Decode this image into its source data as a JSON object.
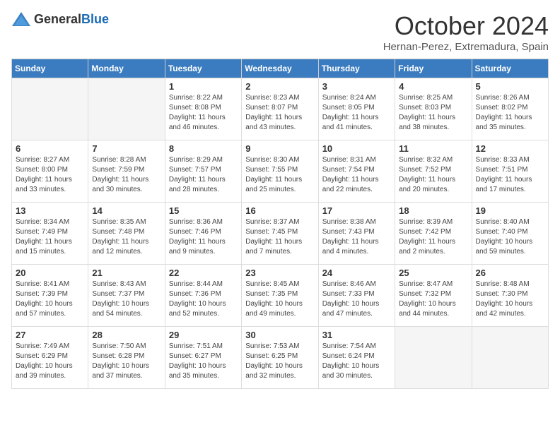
{
  "header": {
    "logo_general": "General",
    "logo_blue": "Blue",
    "month": "October 2024",
    "location": "Hernan-Perez, Extremadura, Spain"
  },
  "days_of_week": [
    "Sunday",
    "Monday",
    "Tuesday",
    "Wednesday",
    "Thursday",
    "Friday",
    "Saturday"
  ],
  "weeks": [
    [
      {
        "day": "",
        "info": ""
      },
      {
        "day": "",
        "info": ""
      },
      {
        "day": "1",
        "info": "Sunrise: 8:22 AM\nSunset: 8:08 PM\nDaylight: 11 hours and 46 minutes."
      },
      {
        "day": "2",
        "info": "Sunrise: 8:23 AM\nSunset: 8:07 PM\nDaylight: 11 hours and 43 minutes."
      },
      {
        "day": "3",
        "info": "Sunrise: 8:24 AM\nSunset: 8:05 PM\nDaylight: 11 hours and 41 minutes."
      },
      {
        "day": "4",
        "info": "Sunrise: 8:25 AM\nSunset: 8:03 PM\nDaylight: 11 hours and 38 minutes."
      },
      {
        "day": "5",
        "info": "Sunrise: 8:26 AM\nSunset: 8:02 PM\nDaylight: 11 hours and 35 minutes."
      }
    ],
    [
      {
        "day": "6",
        "info": "Sunrise: 8:27 AM\nSunset: 8:00 PM\nDaylight: 11 hours and 33 minutes."
      },
      {
        "day": "7",
        "info": "Sunrise: 8:28 AM\nSunset: 7:59 PM\nDaylight: 11 hours and 30 minutes."
      },
      {
        "day": "8",
        "info": "Sunrise: 8:29 AM\nSunset: 7:57 PM\nDaylight: 11 hours and 28 minutes."
      },
      {
        "day": "9",
        "info": "Sunrise: 8:30 AM\nSunset: 7:55 PM\nDaylight: 11 hours and 25 minutes."
      },
      {
        "day": "10",
        "info": "Sunrise: 8:31 AM\nSunset: 7:54 PM\nDaylight: 11 hours and 22 minutes."
      },
      {
        "day": "11",
        "info": "Sunrise: 8:32 AM\nSunset: 7:52 PM\nDaylight: 11 hours and 20 minutes."
      },
      {
        "day": "12",
        "info": "Sunrise: 8:33 AM\nSunset: 7:51 PM\nDaylight: 11 hours and 17 minutes."
      }
    ],
    [
      {
        "day": "13",
        "info": "Sunrise: 8:34 AM\nSunset: 7:49 PM\nDaylight: 11 hours and 15 minutes."
      },
      {
        "day": "14",
        "info": "Sunrise: 8:35 AM\nSunset: 7:48 PM\nDaylight: 11 hours and 12 minutes."
      },
      {
        "day": "15",
        "info": "Sunrise: 8:36 AM\nSunset: 7:46 PM\nDaylight: 11 hours and 9 minutes."
      },
      {
        "day": "16",
        "info": "Sunrise: 8:37 AM\nSunset: 7:45 PM\nDaylight: 11 hours and 7 minutes."
      },
      {
        "day": "17",
        "info": "Sunrise: 8:38 AM\nSunset: 7:43 PM\nDaylight: 11 hours and 4 minutes."
      },
      {
        "day": "18",
        "info": "Sunrise: 8:39 AM\nSunset: 7:42 PM\nDaylight: 11 hours and 2 minutes."
      },
      {
        "day": "19",
        "info": "Sunrise: 8:40 AM\nSunset: 7:40 PM\nDaylight: 10 hours and 59 minutes."
      }
    ],
    [
      {
        "day": "20",
        "info": "Sunrise: 8:41 AM\nSunset: 7:39 PM\nDaylight: 10 hours and 57 minutes."
      },
      {
        "day": "21",
        "info": "Sunrise: 8:43 AM\nSunset: 7:37 PM\nDaylight: 10 hours and 54 minutes."
      },
      {
        "day": "22",
        "info": "Sunrise: 8:44 AM\nSunset: 7:36 PM\nDaylight: 10 hours and 52 minutes."
      },
      {
        "day": "23",
        "info": "Sunrise: 8:45 AM\nSunset: 7:35 PM\nDaylight: 10 hours and 49 minutes."
      },
      {
        "day": "24",
        "info": "Sunrise: 8:46 AM\nSunset: 7:33 PM\nDaylight: 10 hours and 47 minutes."
      },
      {
        "day": "25",
        "info": "Sunrise: 8:47 AM\nSunset: 7:32 PM\nDaylight: 10 hours and 44 minutes."
      },
      {
        "day": "26",
        "info": "Sunrise: 8:48 AM\nSunset: 7:30 PM\nDaylight: 10 hours and 42 minutes."
      }
    ],
    [
      {
        "day": "27",
        "info": "Sunrise: 7:49 AM\nSunset: 6:29 PM\nDaylight: 10 hours and 39 minutes."
      },
      {
        "day": "28",
        "info": "Sunrise: 7:50 AM\nSunset: 6:28 PM\nDaylight: 10 hours and 37 minutes."
      },
      {
        "day": "29",
        "info": "Sunrise: 7:51 AM\nSunset: 6:27 PM\nDaylight: 10 hours and 35 minutes."
      },
      {
        "day": "30",
        "info": "Sunrise: 7:53 AM\nSunset: 6:25 PM\nDaylight: 10 hours and 32 minutes."
      },
      {
        "day": "31",
        "info": "Sunrise: 7:54 AM\nSunset: 6:24 PM\nDaylight: 10 hours and 30 minutes."
      },
      {
        "day": "",
        "info": ""
      },
      {
        "day": "",
        "info": ""
      }
    ]
  ]
}
